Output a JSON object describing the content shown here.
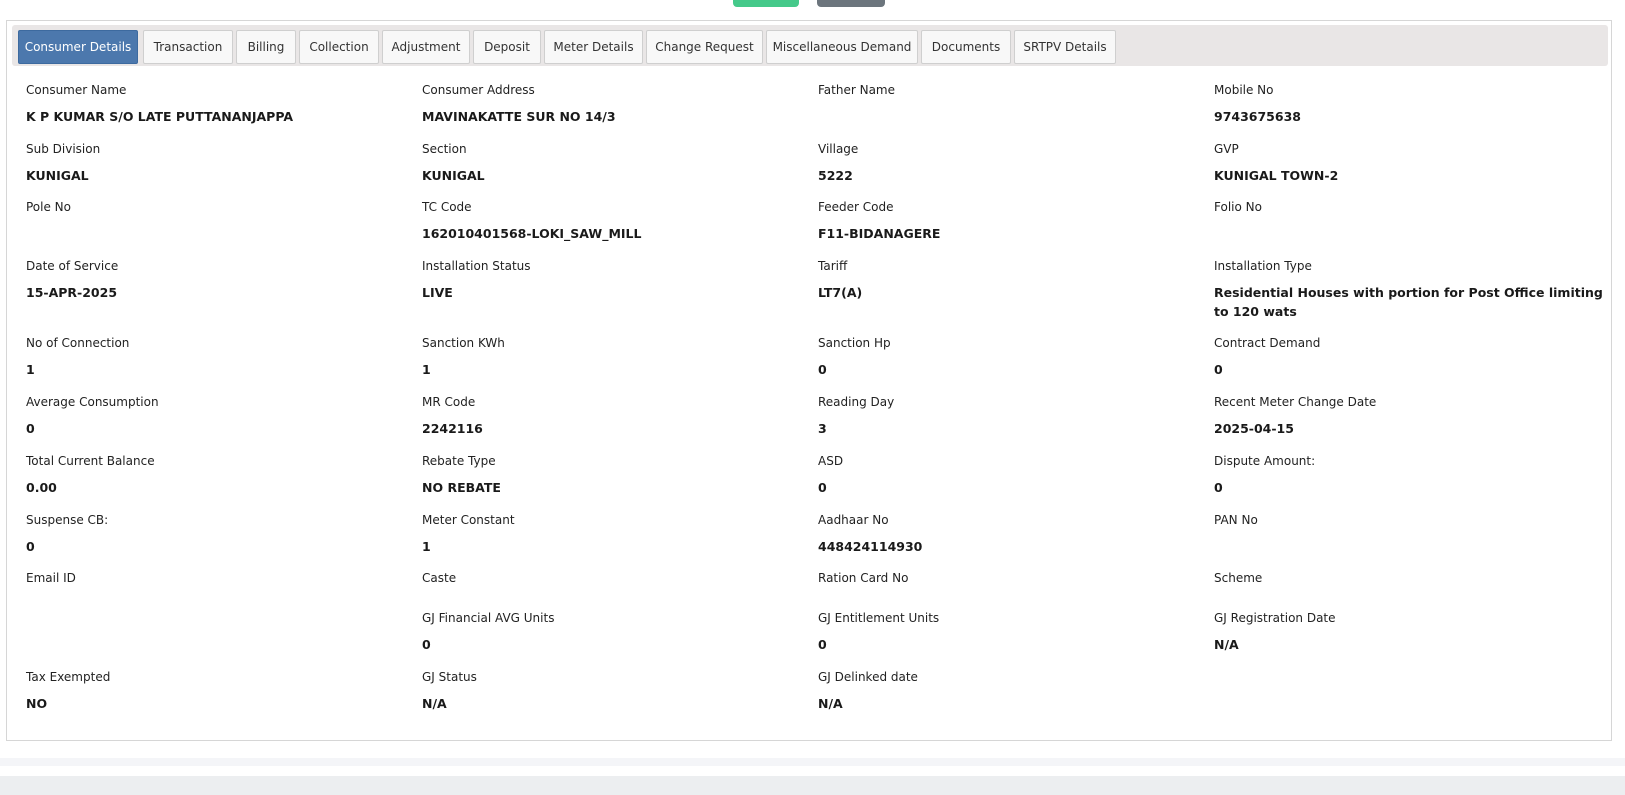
{
  "tabs": [
    {
      "label": "Consumer Details",
      "active": true
    },
    {
      "label": "Transaction"
    },
    {
      "label": "Billing"
    },
    {
      "label": "Collection"
    },
    {
      "label": "Adjustment"
    },
    {
      "label": "Deposit"
    },
    {
      "label": "Meter Details"
    },
    {
      "label": "Change Request"
    },
    {
      "label": "Miscellaneous Demand"
    },
    {
      "label": "Documents"
    },
    {
      "label": "SRTPV Details"
    }
  ],
  "fields": {
    "consumer_name": {
      "label": "Consumer Name",
      "value": "K P KUMAR S/O LATE PUTTANANJAPPA"
    },
    "consumer_address": {
      "label": "Consumer Address",
      "value": "MAVINAKATTE SUR NO 14/3"
    },
    "father_name": {
      "label": "Father Name",
      "value": ""
    },
    "mobile_no": {
      "label": "Mobile No",
      "value": "9743675638"
    },
    "sub_division": {
      "label": "Sub Division",
      "value": "KUNIGAL"
    },
    "section": {
      "label": "Section",
      "value": "KUNIGAL"
    },
    "village": {
      "label": "Village",
      "value": "5222"
    },
    "gvp": {
      "label": "GVP",
      "value": "KUNIGAL TOWN-2"
    },
    "pole_no": {
      "label": "Pole No",
      "value": ""
    },
    "tc_code": {
      "label": "TC Code",
      "value": "162010401568-LOKI_SAW_MILL"
    },
    "feeder_code": {
      "label": "Feeder Code",
      "value": "F11-BIDANAGERE"
    },
    "folio_no": {
      "label": "Folio No",
      "value": ""
    },
    "date_of_service": {
      "label": "Date of Service",
      "value": "15-APR-2025"
    },
    "installation_status": {
      "label": "Installation Status",
      "value": "LIVE"
    },
    "tariff": {
      "label": "Tariff",
      "value": "LT7(A)"
    },
    "installation_type": {
      "label": "Installation Type",
      "value": "Residential Houses with portion for Post Office limiting to 120 wats"
    },
    "no_of_connection": {
      "label": "No of Connection",
      "value": "1"
    },
    "sanction_kwh": {
      "label": "Sanction KWh",
      "value": "1"
    },
    "sanction_hp": {
      "label": "Sanction Hp",
      "value": "0"
    },
    "contract_demand": {
      "label": "Contract Demand",
      "value": "0"
    },
    "average_consumption": {
      "label": "Average Consumption",
      "value": "0"
    },
    "mr_code": {
      "label": "MR Code",
      "value": "2242116"
    },
    "reading_day": {
      "label": "Reading Day",
      "value": "3"
    },
    "recent_meter_change_date": {
      "label": "Recent Meter Change Date",
      "value": "2025-04-15"
    },
    "total_current_balance": {
      "label": "Total Current Balance",
      "value": "0.00"
    },
    "rebate_type": {
      "label": "Rebate Type",
      "value": "NO REBATE"
    },
    "asd": {
      "label": "ASD",
      "value": "0"
    },
    "dispute_amount": {
      "label": "Dispute Amount:",
      "value": "0"
    },
    "suspense_cb": {
      "label": "Suspense CB:",
      "value": "0"
    },
    "meter_constant": {
      "label": "Meter Constant",
      "value": "1"
    },
    "aadhaar_no": {
      "label": "Aadhaar No",
      "value": "448424114930"
    },
    "pan_no": {
      "label": "PAN No",
      "value": ""
    },
    "email_id": {
      "label": "Email ID",
      "value": ""
    },
    "caste": {
      "label": "Caste",
      "value": ""
    },
    "ration_card_no": {
      "label": "Ration Card No",
      "value": ""
    },
    "scheme": {
      "label": "Scheme",
      "value": ""
    },
    "gj_financial_avg_units": {
      "label": "GJ Financial AVG Units",
      "value": "0"
    },
    "gj_entitlement_units": {
      "label": "GJ Entitlement Units",
      "value": "0"
    },
    "gj_registration_date": {
      "label": "GJ Registration Date",
      "value": "N/A"
    },
    "tax_exempted": {
      "label": "Tax Exempted",
      "value": "NO"
    },
    "gj_status": {
      "label": "GJ Status",
      "value": "N/A"
    },
    "gj_delinked_date": {
      "label": "GJ Delinked date",
      "value": "N/A"
    }
  },
  "colors": {
    "active_tab": "#4c78ad",
    "tabbar_bg": "#e9e6e6",
    "green_button": "#45c98a",
    "gray_button": "#6c757d"
  }
}
